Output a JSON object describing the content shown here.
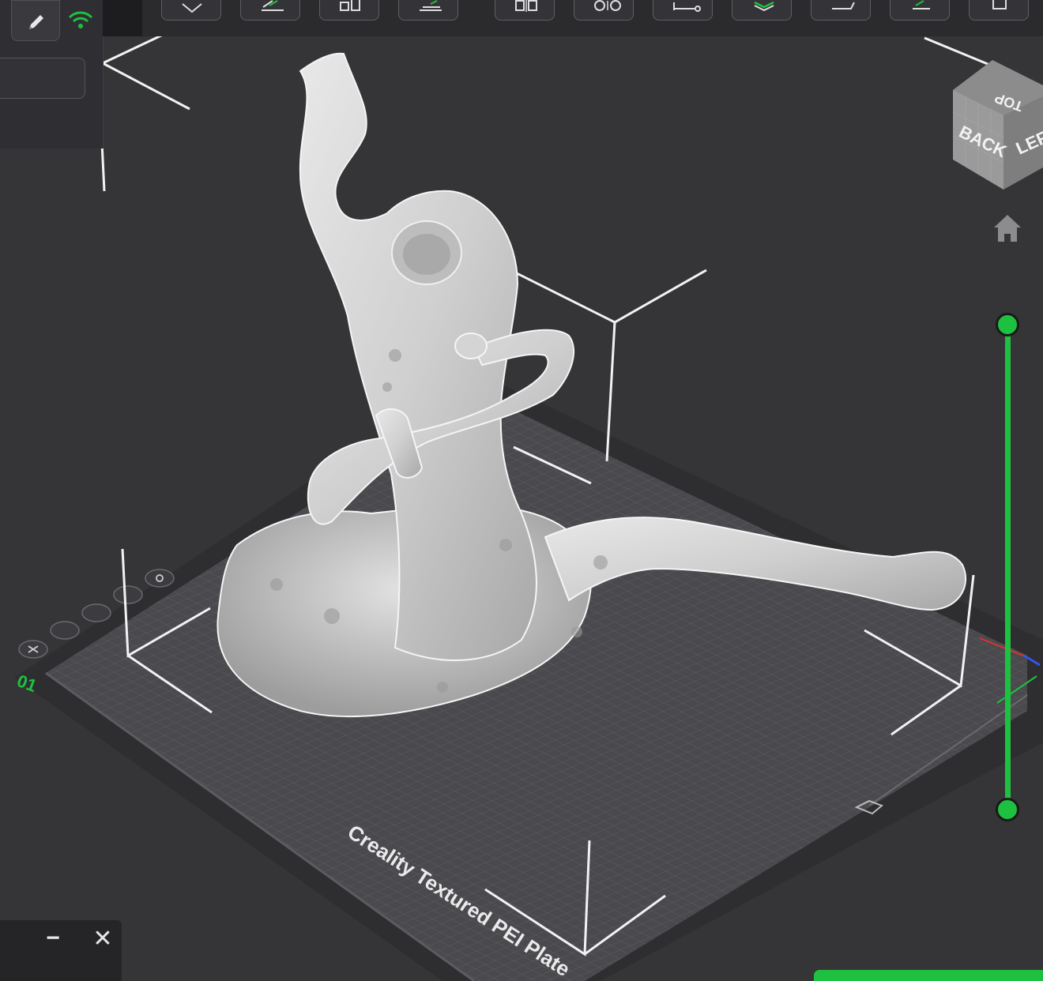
{
  "left_panel": {
    "edit_icon": "pencil-icon",
    "wifi_icon": "wifi-icon"
  },
  "toolbar": {
    "buttons": [
      {
        "name": "rotate-tool",
        "icon": "diamond-icon"
      },
      {
        "name": "lay-flat-tool",
        "icon": "lay-flat-icon"
      },
      {
        "name": "arrange-tool",
        "icon": "arrange-icon"
      },
      {
        "name": "cut-tool",
        "icon": "cut-icon"
      },
      {
        "name": "mirror-tool",
        "icon": "mirror-icon"
      },
      {
        "name": "settings-tool",
        "icon": "gear-pair-icon"
      },
      {
        "name": "measure-tool",
        "icon": "measure-icon"
      },
      {
        "name": "layers-tool",
        "icon": "layers-icon"
      },
      {
        "name": "paint-tool",
        "icon": "paint-icon"
      },
      {
        "name": "support-tool",
        "icon": "support-icon"
      },
      {
        "name": "more-tool",
        "icon": "square-icon"
      }
    ]
  },
  "view_cube": {
    "top_label": "TOP",
    "back_label": "BACK",
    "left_label": "LEF"
  },
  "plate": {
    "name": "Creality Textured PEI Plate",
    "plate_number": "01"
  },
  "layer_slider": {
    "color": "#1ec13f"
  },
  "bottom_bar": {
    "minimize_label": "−",
    "close_label": "✕"
  },
  "colors": {
    "accent": "#1ec13f",
    "background": "#353538",
    "toolbar": "#2b2b2e",
    "model": "#d9d9d9"
  }
}
